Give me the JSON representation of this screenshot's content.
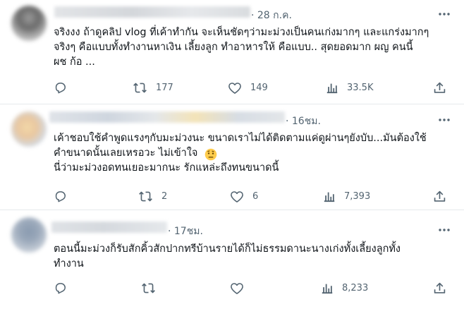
{
  "posts": [
    {
      "time": "· 28 ก.ค.",
      "text": "จริงงง ถ้าดูคลิป vlog ที่เค้าทำกัน จะเห็นชัดๆว่ามะม่วงเป็นคนเก่งมากๆ และแกร่งมากๆ\nจริงๆ คือแบบทั้งทำงานหาเงิน เลี้ยงลูก ทำอาหารให้ คือแบบ.. สุดยอดมาก ผญ คนนี้\nผช ก้อ ...",
      "replies": "",
      "retweets": "177",
      "likes": "149",
      "views": "33.5K"
    },
    {
      "time": "· 16ชม.",
      "text": "เค้าชอบใช้คำพูดแรงๆกับมะม่วงนะ ขนาดเราไม่ได้ติดตามแค่ดูผ่านๆยังบับ...มันต้องใช้\nคำขนาดนั้นเลยเหรอวะ ไม่เข้าใจ\nนี่ว่ามะม่วงอดทนเยอะมากนะ รักแหล่ะถึงทนขนาดนี้",
      "emoji": "🤨",
      "replies": "",
      "retweets": "2",
      "likes": "6",
      "views": "7,393"
    },
    {
      "time": "· 17ชม.",
      "text": "ตอนนี้มะม่วงก็รับสักคิ้วสักปากทรีบ้านรายได้ก็ไม่ธรรมดานะนางเก่งทั้งเลี้ยงลูกทั้ง\nทำงาน",
      "replies": "",
      "retweets": "",
      "likes": "",
      "views": "8,233"
    }
  ],
  "icons": {
    "reply": "reply-icon",
    "retweet": "retweet-icon",
    "like": "heart-icon",
    "views": "views-icon",
    "share": "share-icon",
    "more": "more-dots-icon"
  },
  "colors": {
    "text": "#0f1419",
    "muted": "#536471",
    "divider": "#e6e9ec"
  }
}
